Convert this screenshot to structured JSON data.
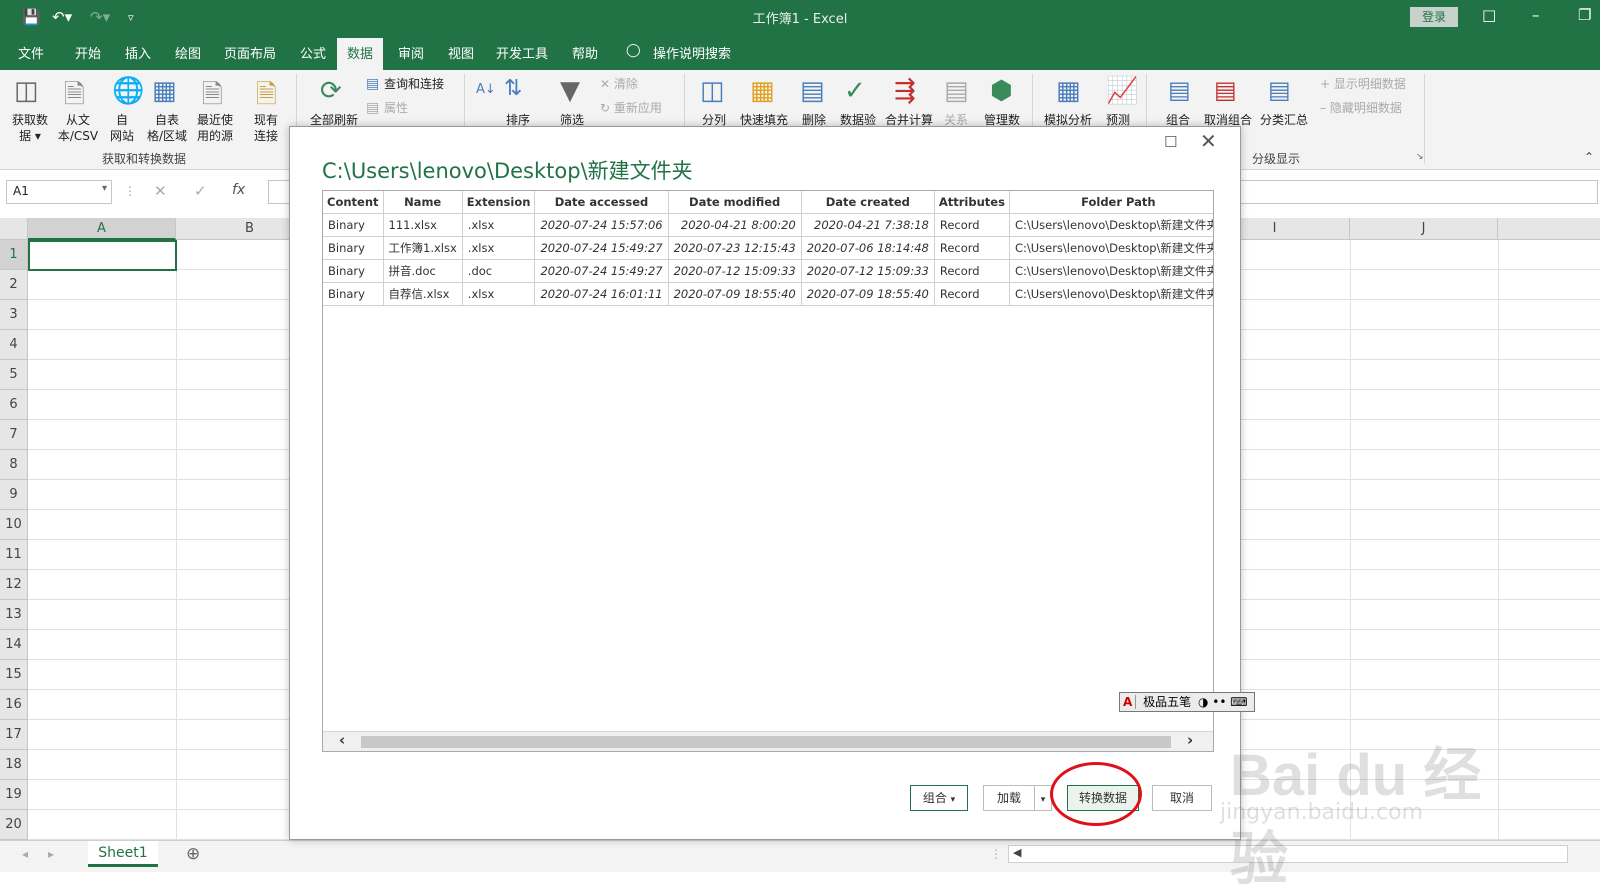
{
  "app": {
    "title": "工作簿1  -  Excel",
    "login": "登录"
  },
  "tabs": [
    "文件",
    "开始",
    "插入",
    "绘图",
    "页面布局",
    "公式",
    "数据",
    "审阅",
    "视图",
    "开发工具",
    "帮助",
    "操作说明搜索"
  ],
  "active_tab": "数据",
  "ribbon": {
    "get_data": [
      "获取数",
      "据"
    ],
    "from_text": [
      "从文",
      "本/CSV"
    ],
    "from_web": [
      "自",
      "网站"
    ],
    "from_table": [
      "自表",
      "格/区域"
    ],
    "recent": [
      "最近使",
      "用的源"
    ],
    "existing": [
      "现有",
      "连接"
    ],
    "group_get_transform": "获取和转换数据",
    "refresh_all": "全部刷新",
    "queries": "查询和连接",
    "properties": "属性",
    "sort": "排序",
    "filter": "筛选",
    "clear": "清除",
    "reapply": "重新应用",
    "split": "分列",
    "flash_fill": "快速填充",
    "remove_dup": "删除",
    "validation": "数据验",
    "consolidate": "合并计算",
    "relations": "关系",
    "manage": "管理数",
    "whatif": "模拟分析",
    "forecast": "预测",
    "group": "组合",
    "ungroup": "取消组合",
    "subtotal": "分类汇总",
    "show_detail": "显示明细数据",
    "hide_detail": "隐藏明细数据",
    "group_outline": "分级显示"
  },
  "formula": {
    "namebox": "A1",
    "fx": "fx"
  },
  "columns": [
    "A",
    "B",
    "I",
    "J"
  ],
  "rows": [
    "1",
    "2",
    "3",
    "4",
    "5",
    "6",
    "7",
    "8",
    "9",
    "10",
    "11",
    "12",
    "13",
    "14",
    "15",
    "16",
    "17",
    "18",
    "19",
    "20"
  ],
  "sheet": {
    "tab": "Sheet1"
  },
  "dialog": {
    "title": "C:\\Users\\lenovo\\Desktop\\新建文件夹",
    "headers": [
      "Content",
      "Name",
      "Extension",
      "Date accessed",
      "Date modified",
      "Date created",
      "Attributes",
      "Folder Path"
    ],
    "rows": [
      [
        "Binary",
        "111.xlsx",
        ".xlsx",
        "2020-07-24 15:57:06",
        "2020-04-21 8:00:20",
        "2020-04-21 7:38:18",
        "Record",
        "C:\\Users\\lenovo\\Desktop\\新建文件夹\\"
      ],
      [
        "Binary",
        "工作簿1.xlsx",
        ".xlsx",
        "2020-07-24 15:49:27",
        "2020-07-23 12:15:43",
        "2020-07-06 18:14:48",
        "Record",
        "C:\\Users\\lenovo\\Desktop\\新建文件夹\\"
      ],
      [
        "Binary",
        "拼音.doc",
        ".doc",
        "2020-07-24 15:49:27",
        "2020-07-12 15:09:33",
        "2020-07-12 15:09:33",
        "Record",
        "C:\\Users\\lenovo\\Desktop\\新建文件夹\\"
      ],
      [
        "Binary",
        "自荐信.xlsx",
        ".xlsx",
        "2020-07-24 16:01:11",
        "2020-07-09 18:55:40",
        "2020-07-09 18:55:40",
        "Record",
        "C:\\Users\\lenovo\\Desktop\\新建文件夹\\"
      ]
    ],
    "buttons": {
      "combine": "组合",
      "load": "加载",
      "transform": "转换数据",
      "cancel": "取消"
    }
  },
  "ime": {
    "label": "极品五笔"
  },
  "watermark": {
    "logo": "Bai du 经验",
    "url": "jingyan.baidu.com"
  },
  "colors": {
    "accent": "#217346",
    "highlight": "#e0101a"
  }
}
